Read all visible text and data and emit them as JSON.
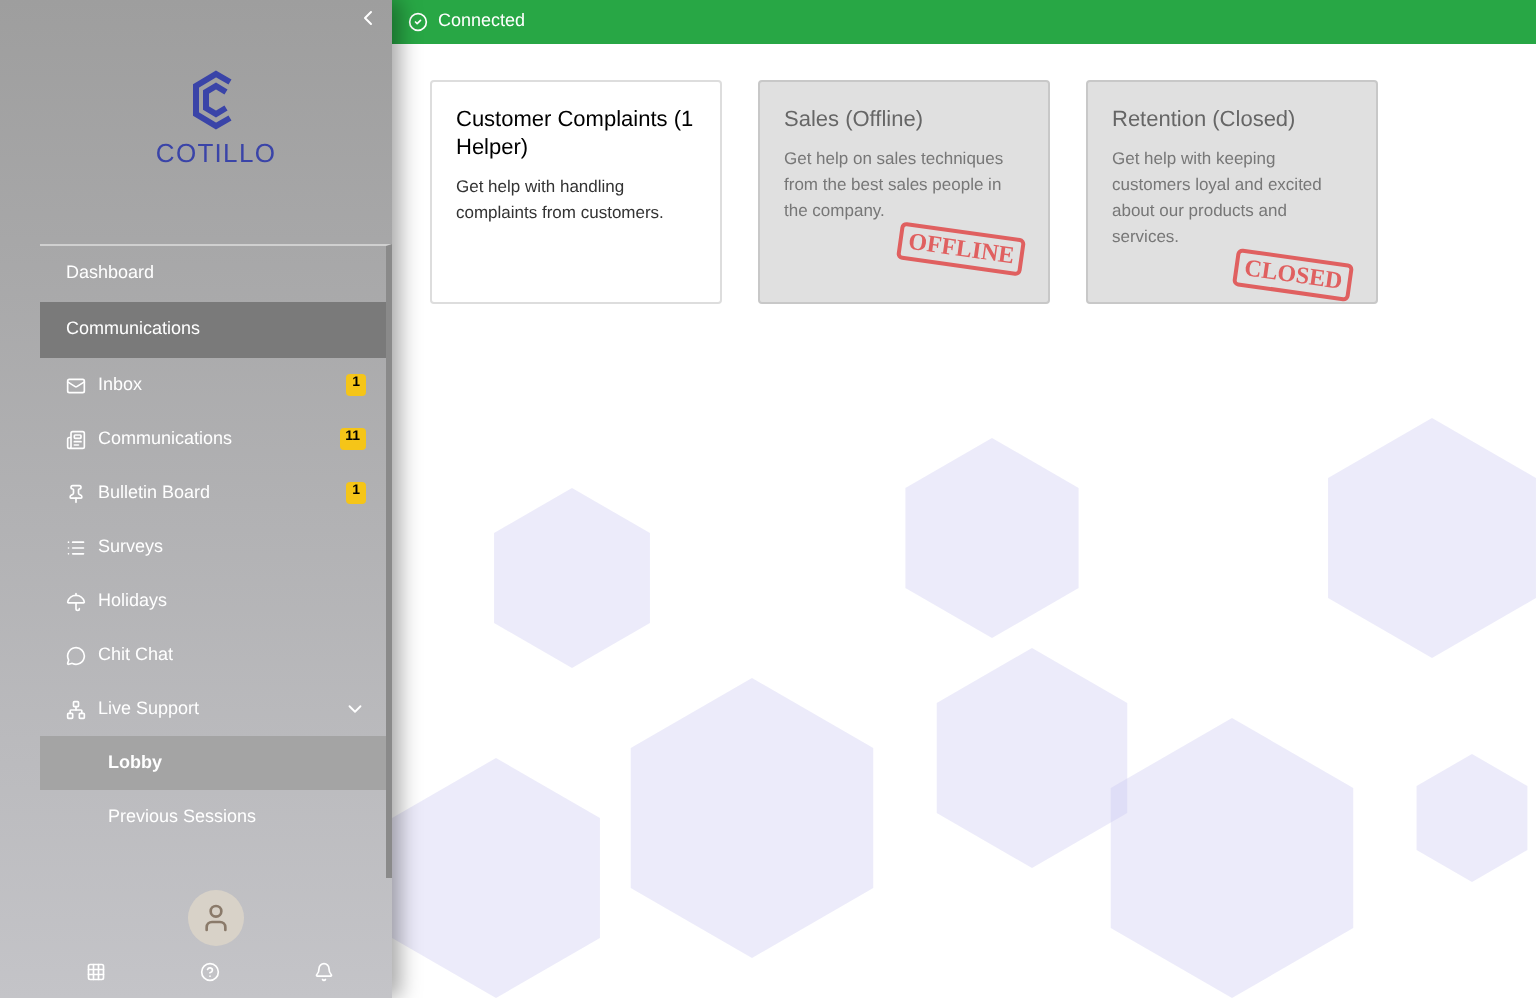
{
  "sidebar": {
    "logo_text": "COTILLO",
    "sections": [
      {
        "label": "Dashboard",
        "selected": false
      },
      {
        "label": "Communications",
        "selected": true
      }
    ],
    "items": [
      {
        "label": "Inbox",
        "badge": "1"
      },
      {
        "label": "Communications",
        "badge": "11"
      },
      {
        "label": "Bulletin Board",
        "badge": "1"
      },
      {
        "label": "Surveys"
      },
      {
        "label": "Holidays"
      },
      {
        "label": "Chit Chat"
      },
      {
        "label": "Live Support",
        "expanded": true,
        "children": [
          {
            "label": "Lobby",
            "selected": true
          },
          {
            "label": "Previous Sessions",
            "selected": false
          }
        ]
      }
    ]
  },
  "status_bar": {
    "text": "Connected"
  },
  "cards": [
    {
      "title": "Customer Complaints (1 Helper)",
      "description": "Get help with handling complaints from customers."
    },
    {
      "title": "Sales (Offline)",
      "description": "Get help on sales techniques from the best sales people in the company.",
      "stamp": "OFFLINE"
    },
    {
      "title": "Retention (Closed)",
      "description": "Get help with keeping customers loyal and excited about our products and services.",
      "stamp": "CLOSED"
    }
  ]
}
